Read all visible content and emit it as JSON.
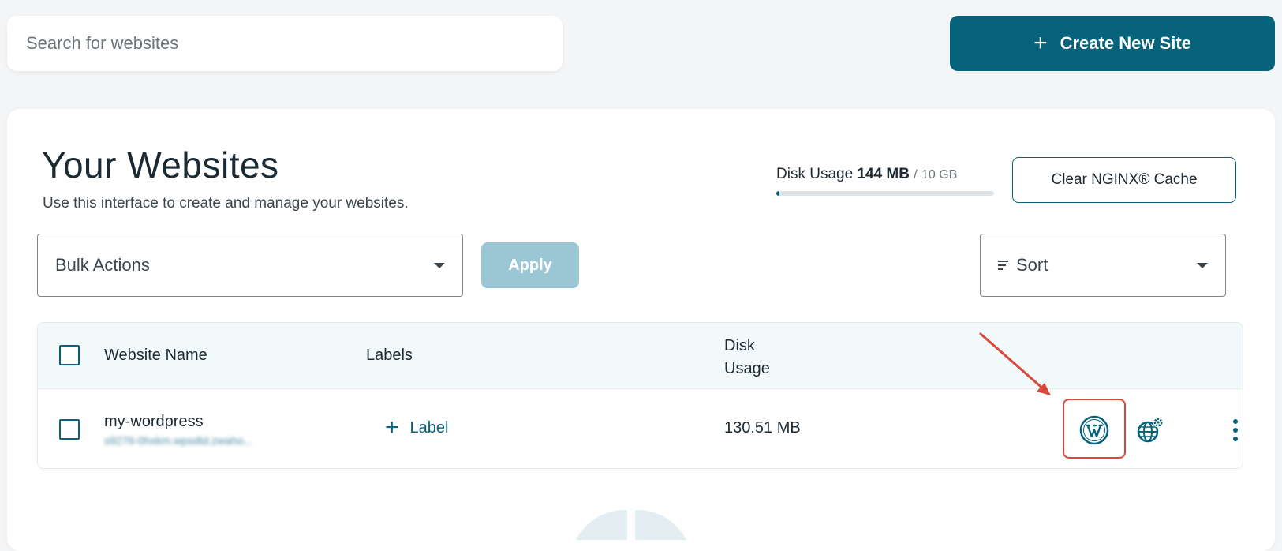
{
  "search": {
    "placeholder": "Search for websites"
  },
  "create_button": {
    "plus": "+",
    "label": "Create New Site"
  },
  "main": {
    "title": "Your Websites",
    "subtitle": "Use this interface to create and manage your websites."
  },
  "disk_summary": {
    "label": "Disk Usage",
    "used": "144 MB",
    "separator": "/",
    "total": "10 GB",
    "usage_fraction": 0.014
  },
  "nginx_button": {
    "label": "Clear NGINX® Cache"
  },
  "bulk_actions": {
    "selected": "Bulk Actions"
  },
  "apply_button": {
    "label": "Apply"
  },
  "sort": {
    "selected": "Sort"
  },
  "table": {
    "columns": [
      "Website Name",
      "Labels",
      "Disk Usage"
    ],
    "disk_header_line1": "Disk",
    "disk_header_line2": "Usage",
    "rows": [
      {
        "name": "my-wordpress",
        "url": "s9276-0hxkm.wpsdtd.zwaho...",
        "label_action_plus": "+",
        "label_action": "Label",
        "disk_usage": "130.51 MB",
        "actions": [
          "wordpress-icon",
          "globe-gear-icon",
          "more-vertical-icon"
        ]
      }
    ]
  },
  "colors": {
    "accent": "#07627c",
    "apply_disabled": "#9bc6d3",
    "highlight": "#d9483b",
    "header_bg": "#f1f9fb"
  }
}
